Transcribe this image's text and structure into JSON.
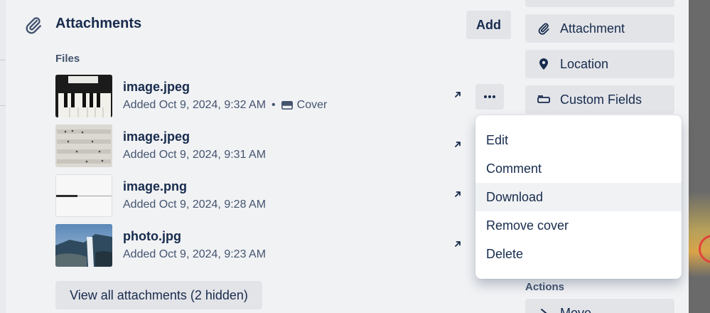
{
  "attachments": {
    "title": "Attachments",
    "add_label": "Add",
    "files_label": "Files",
    "files": [
      {
        "name": "image.jpeg",
        "added": "Added Oct 9, 2024, 9:32 AM",
        "separator": "•",
        "cover_label": "Cover",
        "thumb": "piano-keys"
      },
      {
        "name": "image.jpeg",
        "added": "Added Oct 9, 2024, 9:31 AM",
        "thumb": "sheet-music"
      },
      {
        "name": "image.png",
        "added": "Added Oct 9, 2024, 9:28 AM",
        "thumb": "screenshot"
      },
      {
        "name": "photo.jpg",
        "added": "Added Oct 9, 2024, 9:23 AM",
        "thumb": "waterfall"
      }
    ],
    "view_all_label": "View all attachments (2 hidden)"
  },
  "sidebar": {
    "buttons": [
      {
        "label": "Attachment",
        "icon": "paperclip-icon"
      },
      {
        "label": "Location",
        "icon": "location-pin-icon"
      },
      {
        "label": "Custom Fields",
        "icon": "custom-fields-icon"
      }
    ],
    "actions_label": "Actions",
    "move_label": "Move"
  },
  "menu": {
    "items": [
      "Edit",
      "Comment",
      "Download",
      "Remove cover",
      "Delete"
    ],
    "hovered": "Download"
  },
  "colors": {
    "panel": "#f1f2f4",
    "button": "#e3e4e8",
    "text": "#172b4d",
    "subtext": "#44546f",
    "menu_bg": "#ffffff"
  }
}
